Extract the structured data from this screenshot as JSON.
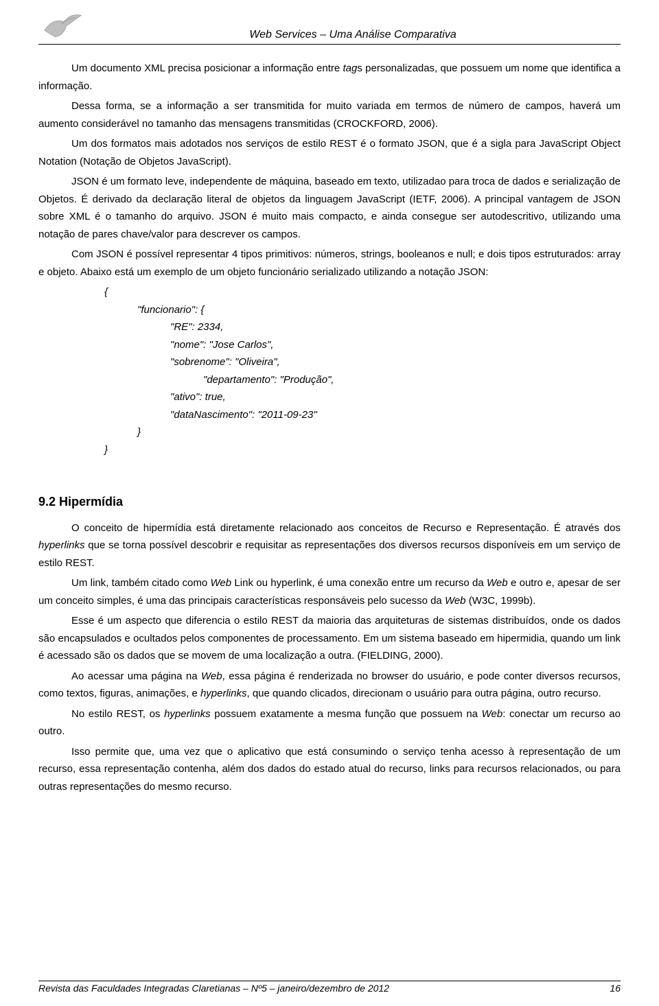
{
  "header": {
    "title": "Web Services – Uma Análise Comparativa"
  },
  "paragraphs": {
    "p1a": "Um documento XML precisa posicionar a informação entre ",
    "p1b": "tag",
    "p1c": "s personalizadas, que possuem um nome que identifica a informação.",
    "p2": "Dessa forma, se a informação a ser transmitida for muito variada em termos de número de campos, haverá um aumento considerável no tamanho das mensagens transmitidas (CROCKFORD, 2006).",
    "p3": "Um dos formatos mais adotados nos serviços de estilo REST é o formato JSON, que é a sigla para JavaScript Object Notation (Notação de Objetos JavaScript).",
    "p4a": "JSON é um formato leve, independente de máquina, baseado em texto, utilizadao para troca de dados e serialização de Objetos. É derivado da declaração literal de objetos da linguagem JavaScript (IETF, 2006). A principal van",
    "p4b": "tag",
    "p4c": "em de JSON sobre XML é o tamanho do arquivo. JSON é muito mais compacto, e ainda consegue ser autodescritivo, utilizando uma notação de pares chave/valor para descrever os campos.",
    "p5": "Com JSON é possível representar 4 tipos primitivos: números, strings, booleanos e null; e dois tipos estruturados: array e objeto. Abaixo está um exemplo de um objeto funcionário serializado utilizando a notação JSON:"
  },
  "code": {
    "l1": "{",
    "l2": "\"funcionario\": {",
    "l3": "\"RE\": 2334,",
    "l4": "\"nome\": \"Jose Carlos\",",
    "l5": "\"sobrenome\": \"Oliveira\",",
    "l6": "\"departamento\": \"Produção\",",
    "l7": "\"ativo\": true,",
    "l8": "\"dataNascimento\": \"2011-09-23\"",
    "l9": "}",
    "l10": "}"
  },
  "section": {
    "heading": "9.2 Hipermídia",
    "s1a": "O conceito de hipermídia está diretamente relacionado aos conceitos de Recurso e Representação. É através dos ",
    "s1b": "hyperlinks",
    "s1c": " que se torna possível descobrir e requisitar as representações dos diversos recursos disponíveis em um serviço de estilo REST.",
    "s2a": "Um link, também citado como  ",
    "s2b": "Web",
    "s2c": " Link ou hyperlink, é uma conexão entre um recurso da ",
    "s2d": "Web",
    "s2e": " e outro e, apesar de ser um conceito simples, é uma das principais características responsáveis pelo sucesso da ",
    "s2f": "Web",
    "s2g": " (W3C, 1999b).",
    "s3": "Esse é um aspecto que diferencia o estilo REST da maioria das arquiteturas de sistemas distribuídos, onde os dados são encapsulados e ocultados pelos componentes de processamento. Em um sistema baseado em hipermidia, quando um link é acessado são os dados que se movem de uma localização a outra. (FIELDING, 2000).",
    "s4a": "Ao acessar uma página na ",
    "s4b": "Web",
    "s4c": ", essa página é renderizada no browser do usuário, e pode conter diversos recursos, como textos, figuras, animações, e ",
    "s4d": "hyperlinks",
    "s4e": ", que quando clicados, direcionam o usuário para outra página, outro recurso.",
    "s5a": " No estilo REST, os ",
    "s5b": "hyperlinks",
    "s5c": " possuem exatamente a mesma função que possuem na ",
    "s5d": "Web",
    "s5e": ": conectar um recurso ao outro.",
    "s6": "Isso permite que, uma vez que o aplicativo que está consumindo o serviço tenha acesso à representação de um recurso, essa representação contenha, além dos dados do estado atual do recurso, links para recursos relacionados, ou para outras representações do mesmo recurso."
  },
  "footer": {
    "left": "Revista das Faculdades Integradas Claretianas – Nº5  – janeiro/dezembro de 2012",
    "right": "16"
  }
}
